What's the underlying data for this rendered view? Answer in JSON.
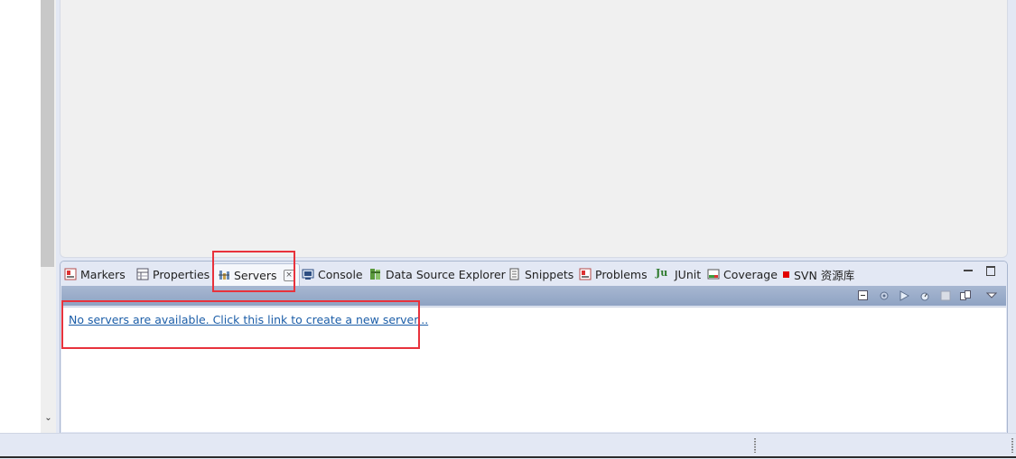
{
  "left_panel": {
    "chevron": "⌄"
  },
  "tabs": [
    {
      "id": "markers",
      "label": "Markers",
      "icon": "markers-icon"
    },
    {
      "id": "properties",
      "label": "Properties",
      "icon": "properties-icon"
    },
    {
      "id": "servers",
      "label": "Servers",
      "icon": "servers-icon",
      "active": true
    },
    {
      "id": "console",
      "label": "Console",
      "icon": "console-icon"
    },
    {
      "id": "data-source-explorer",
      "label": "Data Source Explorer",
      "icon": "database-icon"
    },
    {
      "id": "snippets",
      "label": "Snippets",
      "icon": "snippets-icon"
    },
    {
      "id": "problems",
      "label": "Problems",
      "icon": "problems-icon"
    },
    {
      "id": "junit",
      "label": "JUnit",
      "icon": "junit-icon",
      "icon_text": "Ju"
    },
    {
      "id": "coverage",
      "label": "Coverage",
      "icon": "coverage-icon"
    },
    {
      "id": "svn",
      "label": "SVN 资源库",
      "icon": "svn-icon"
    }
  ],
  "close_glyph": "×",
  "toolbar_icons": [
    "collapse-icon",
    "debug-server-icon",
    "start-server-icon",
    "profile-server-icon",
    "stop-server-icon",
    "publish-icon",
    "view-menu-icon"
  ],
  "servers_view": {
    "empty_link": "No servers are available. Click this link to create a new server..."
  },
  "colors": {
    "highlight": "#e8323c",
    "link": "#1c5ea8",
    "toolbar": "#9aabca"
  }
}
